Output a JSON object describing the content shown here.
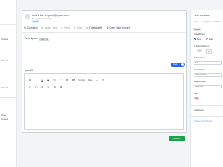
{
  "left_column": {
    "items": [
      "Closed",
      "Closed",
      "Closed",
      "Open",
      "Closed"
    ]
  },
  "ticket": {
    "from": "Kami & Bay <beyouco@legacor.com>",
    "sent": "Sent: just now, 3 ways",
    "badge": "Email",
    "toolbar": [
      {
        "label": "Open Mail",
        "icon": "✉",
        "disabled": false
      },
      {
        "label": "Assign Ticket",
        "icon": "⇄",
        "disabled": true
      },
      {
        "label": "Reply",
        "icon": "↩",
        "disabled": true
      },
      {
        "label": "Snap",
        "icon": "⎘",
        "disabled": true
      },
      {
        "label": "Ticket Activity",
        "icon": "◷",
        "disabled": false
      },
      {
        "label": "Open Ticket Property",
        "icon": "⚙",
        "disabled": false
      }
    ],
    "signature_label": "Test signure",
    "signature_tag": "SERVICE",
    "toggle_label": "Macro",
    "reply_label": "pwmtl 5"
  },
  "editor": {
    "row1": [
      "B",
      "I",
      "U",
      "S",
      "</>",
      "❝",
      "⇆",
      "⇄"
    ],
    "format_select": "Normal",
    "font_select": "Sans",
    "row1_tail": [
      "⌄",
      "≡"
    ],
    "row2": [
      "✎",
      "⤺",
      "⊘",
      "☺",
      "⊞",
      "▣"
    ]
  },
  "continue_button": "Continue",
  "right_panel": {
    "title": "Ticket Properties",
    "tabs": [
      "Open",
      "In progress",
      "Pending"
    ],
    "closed_chip": "Closed",
    "priority_label": "Ticket Priority",
    "priority_options": [
      "Minor",
      "Major"
    ],
    "direct_customer_label": "Is Direct Customer",
    "yes_no": [
      "Yes",
      "No"
    ],
    "problem_area_label": "Problem Area",
    "problem_area_value": "ER",
    "problem_type_label": "Problem Type",
    "problem_type_value": "Data Incorrect",
    "setup_reason_label": "Setup Reason",
    "setup_reason_value": "Data Taker",
    "tags_label": "Tags",
    "tag_value": "Test",
    "contributors_label": "Contributors",
    "add_contributor_link": "Unassign Contributors"
  }
}
